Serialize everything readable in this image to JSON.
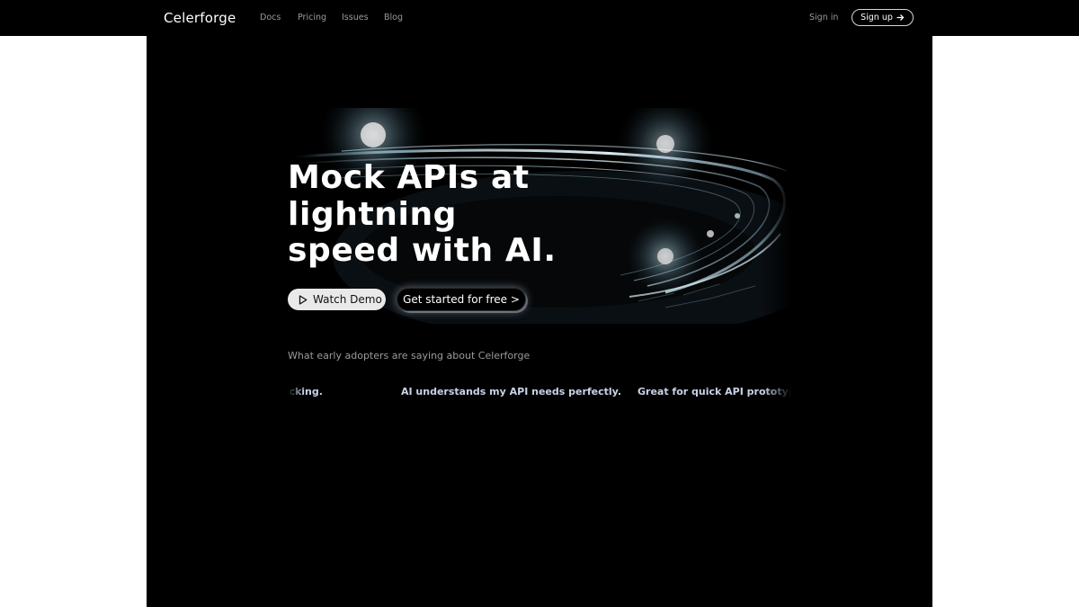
{
  "header": {
    "brand": "Celerforge",
    "nav": [
      {
        "label": "Docs"
      },
      {
        "label": "Pricing"
      },
      {
        "label": "Issues"
      },
      {
        "label": "Blog"
      }
    ],
    "sign_in": "Sign in",
    "sign_up": "Sign up",
    "sign_up_icon": "arrow-right-icon"
  },
  "hero": {
    "headline_lines": [
      "Mock APIs at",
      "lightning",
      "speed with AI."
    ],
    "watch_demo": "Watch Demo",
    "watch_demo_icon": "play-icon",
    "get_started": "Get started for free >"
  },
  "testimonials": {
    "intro": "What early adopters are saying about Celerforge",
    "quotes": [
      "Fast API mocking.",
      "AI understands my API needs perfectly.",
      "Great for quick API prototyping."
    ]
  },
  "colors": {
    "background": "#000000",
    "page": "#ffffff",
    "quote_text": "#c9d2e8",
    "muted_text": "#9b9b9b"
  }
}
